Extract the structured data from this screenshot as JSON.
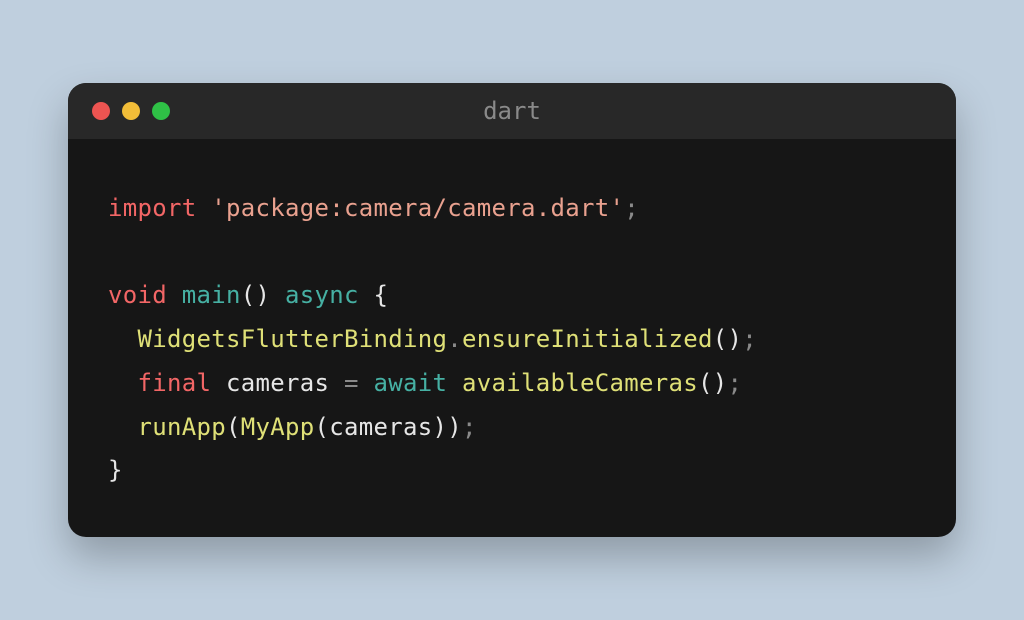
{
  "window": {
    "title": "dart",
    "traffic_lights": {
      "red": "#ed5451",
      "yellow": "#f2bd38",
      "green": "#2fc146"
    }
  },
  "code": {
    "language": "dart",
    "tokens": {
      "import_kw": "import",
      "import_str": "'package:camera/camera.dart'",
      "semi": ";",
      "void_kw": "void",
      "main_fn": "main",
      "lparen": "(",
      "rparen": ")",
      "async_kw": "async",
      "lbrace": "{",
      "rbrace": "}",
      "widgets_binding": "WidgetsFlutterBinding",
      "dot": ".",
      "ensure_init": "ensureInitialized",
      "final_kw": "final",
      "cameras_var": "cameras",
      "equals": "=",
      "await_kw": "await",
      "available_cameras": "availableCameras",
      "run_app": "runApp",
      "my_app": "MyApp",
      "cameras_arg": "cameras",
      "indent": "  "
    }
  }
}
